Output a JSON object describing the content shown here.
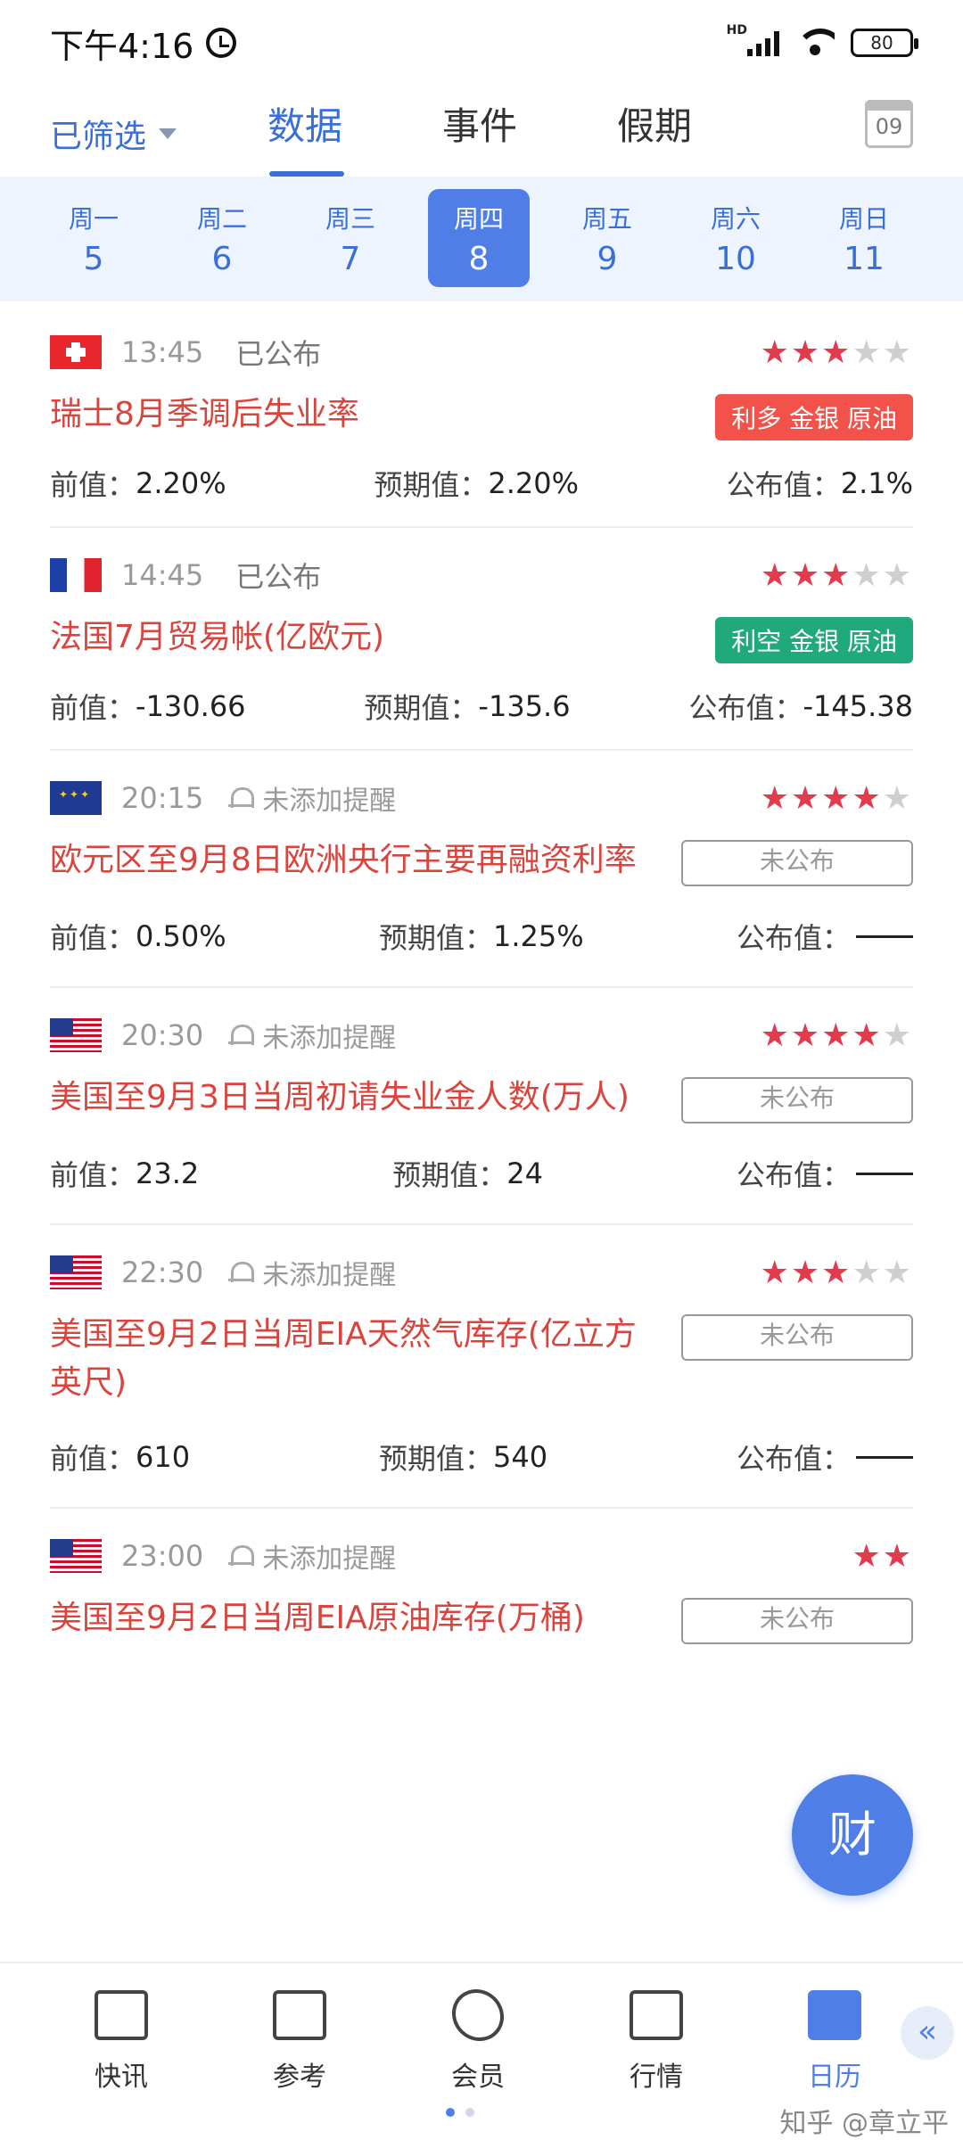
{
  "status_bar": {
    "time": "下午4:16",
    "network": "HD",
    "battery": "80"
  },
  "header": {
    "filter_label": "已筛选",
    "tabs": [
      "数据",
      "事件",
      "假期"
    ],
    "calendar_day": "09"
  },
  "week": [
    {
      "weekday": "周一",
      "date": "5"
    },
    {
      "weekday": "周二",
      "date": "6"
    },
    {
      "weekday": "周三",
      "date": "7"
    },
    {
      "weekday": "周四",
      "date": "8"
    },
    {
      "weekday": "周五",
      "date": "9"
    },
    {
      "weekday": "周六",
      "date": "10"
    },
    {
      "weekday": "周日",
      "date": "11"
    }
  ],
  "selected_day_index": 3,
  "labels": {
    "previous": "前值：",
    "forecast": "预期值：",
    "actual": "公布值："
  },
  "events": [
    {
      "flag": "switzerland-flag",
      "time": "13:45",
      "status": "已公布",
      "reminder": "",
      "stars": 3,
      "title": "瑞士8月季调后失业率",
      "tag": "利多 金银 原油",
      "tag_type": "up",
      "previous": "2.20%",
      "forecast": "2.20%",
      "actual": "2.1%"
    },
    {
      "flag": "france-flag",
      "time": "14:45",
      "status": "已公布",
      "reminder": "",
      "stars": 3,
      "title": "法国7月贸易帐(亿欧元)",
      "tag": "利空 金银 原油",
      "tag_type": "down",
      "previous": "-130.66",
      "forecast": "-135.6",
      "actual": "-145.38"
    },
    {
      "flag": "eu-flag",
      "time": "20:15",
      "status": "",
      "reminder": "未添加提醒",
      "stars": 4,
      "title": "欧元区至9月8日欧洲央行主要再融资利率",
      "tag": "未公布",
      "tag_type": "pending",
      "previous": "0.50%",
      "forecast": "1.25%",
      "actual": ""
    },
    {
      "flag": "us-flag",
      "time": "20:30",
      "status": "",
      "reminder": "未添加提醒",
      "stars": 4,
      "title": "美国至9月3日当周初请失业金人数(万人)",
      "tag": "未公布",
      "tag_type": "pending",
      "previous": "23.2",
      "forecast": "24",
      "actual": ""
    },
    {
      "flag": "us-flag",
      "time": "22:30",
      "status": "",
      "reminder": "未添加提醒",
      "stars": 3,
      "title": "美国至9月2日当周EIA天然气库存(亿立方英尺)",
      "tag": "未公布",
      "tag_type": "pending",
      "previous": "610",
      "forecast": "540",
      "actual": ""
    },
    {
      "flag": "us-flag",
      "time": "23:00",
      "status": "",
      "reminder": "未添加提醒",
      "stars": 2,
      "title": "美国至9月2日当周EIA原油库存(万桶)",
      "tag": "未公布",
      "tag_type": "pending",
      "previous": "",
      "forecast": "",
      "actual": ""
    }
  ],
  "fab_label": "财",
  "bottom_nav": [
    {
      "label": "快讯",
      "icon": "newspaper-icon"
    },
    {
      "label": "参考",
      "icon": "reference-card-icon"
    },
    {
      "label": "会员",
      "icon": "vip-diamond-icon"
    },
    {
      "label": "行情",
      "icon": "chart-trend-icon"
    },
    {
      "label": "日历",
      "icon": "calendar-icon"
    }
  ],
  "collapse_label": "«",
  "watermark": "知乎 @章立平"
}
